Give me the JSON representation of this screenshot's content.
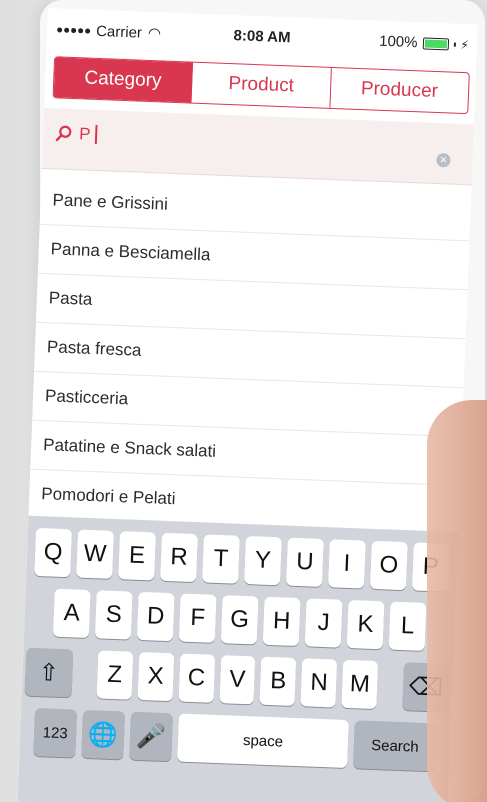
{
  "status_bar": {
    "carrier": "Carrier",
    "time": "8:08 AM",
    "battery": "100%"
  },
  "tabs": [
    {
      "label": "Category",
      "active": true
    },
    {
      "label": "Product",
      "active": false
    },
    {
      "label": "Producer",
      "active": false
    }
  ],
  "search": {
    "value": "P",
    "placeholder": ""
  },
  "results": [
    "Pane e Grissini",
    "Panna e Besciamella",
    "Pasta",
    "Pasta fresca",
    "Pasticceria",
    "Patatine e Snack salati",
    "Pomodori e Pelati"
  ],
  "keyboard": {
    "row1": [
      "Q",
      "W",
      "E",
      "R",
      "T",
      "Y",
      "U",
      "I",
      "O",
      "P"
    ],
    "row2": [
      "A",
      "S",
      "D",
      "F",
      "G",
      "H",
      "J",
      "K",
      "L"
    ],
    "row3": [
      "Z",
      "X",
      "C",
      "V",
      "B",
      "N",
      "M"
    ],
    "numbers_label": "123",
    "space_label": "space",
    "search_label": "Search"
  },
  "colors": {
    "accent": "#d9364f",
    "search_bg": "#f7eeee",
    "keyboard_bg": "#d1d5db"
  }
}
